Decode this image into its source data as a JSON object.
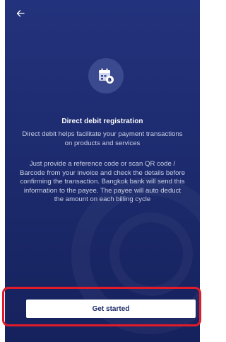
{
  "header": {
    "back_icon": "arrow-left-icon"
  },
  "hero": {
    "icon": "calendar-baht-icon"
  },
  "content": {
    "title": "Direct debit registration",
    "description": "Direct debit helps facilitate your payment transactions on products and services",
    "details": "Just provide a reference code or scan QR code / Barcode from your invoice and check the details before confirming the transaction. Bangkok bank will send this information to the payee. The payee will auto deduct the amount on each billing cycle"
  },
  "cta": {
    "label": "Get started"
  },
  "colors": {
    "background": "#1d2b6f",
    "highlight_outline": "#e21b2a",
    "button_bg": "#ffffff",
    "button_text": "#1c2a6b"
  }
}
